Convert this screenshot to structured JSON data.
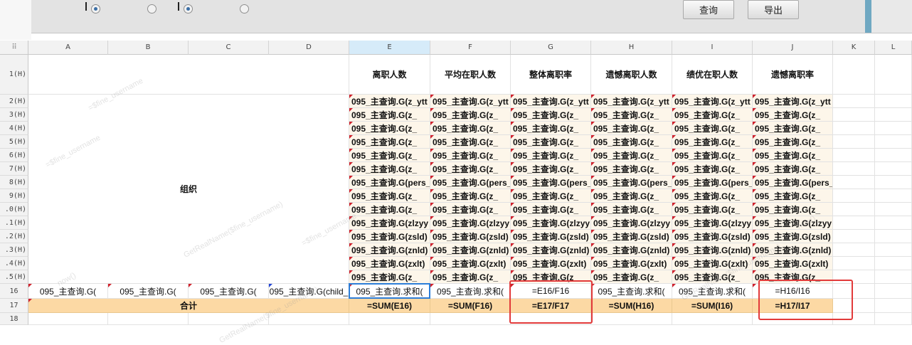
{
  "toolbar": {
    "query_label": "查询",
    "export_label": "导出"
  },
  "columns": [
    "A",
    "B",
    "C",
    "D",
    "E",
    "F",
    "G",
    "H",
    "I",
    "J",
    "K",
    "L"
  ],
  "corner_glyph": "⠿",
  "row_labels": [
    "1(H)",
    "2(H)",
    "3(H)",
    "4(H)",
    "5(H)",
    "6(H)",
    "7(H)",
    "8(H)",
    "9(H)",
    ".0(H)",
    ".1(H)",
    ".2(H)",
    ".3(H)",
    ".4(H)",
    ".5(H)",
    "16",
    "17",
    "18"
  ],
  "header_row": [
    "离职人数",
    "平均在职人数",
    "整体离职率",
    "遗憾离职人数",
    "绩优在职人数",
    "遗憾离职率"
  ],
  "org_label": "组织",
  "expr_rows": [
    [
      "095_主查询.G(z_ytt",
      "095_主查询.G(z_ytt",
      "095_主查询.G(z_ytt",
      "095_主查询.G(z_ytt",
      "095_主查询.G(z_ytt",
      "095_主查询.G(z_ytt"
    ],
    [
      "095_主查询.G(z_",
      "095_主查询.G(z_",
      "095_主查询.G(z_",
      "095_主查询.G(z_",
      "095_主查询.G(z_",
      "095_主查询.G(z_"
    ],
    [
      "095_主查询.G(z_",
      "095_主查询.G(z_",
      "095_主查询.G(z_",
      "095_主查询.G(z_",
      "095_主查询.G(z_",
      "095_主查询.G(z_"
    ],
    [
      "095_主查询.G(z_",
      "095_主查询.G(z_",
      "095_主查询.G(z_",
      "095_主查询.G(z_",
      "095_主查询.G(z_",
      "095_主查询.G(z_"
    ],
    [
      "095_主查询.G(z_",
      "095_主查询.G(z_",
      "095_主查询.G(z_",
      "095_主查询.G(z_",
      "095_主查询.G(z_",
      "095_主查询.G(z_"
    ],
    [
      "095_主查询.G(z_",
      "095_主查询.G(z_",
      "095_主查询.G(z_",
      "095_主查询.G(z_",
      "095_主查询.G(z_",
      "095_主查询.G(z_"
    ],
    [
      "095_主查询.G(pers_",
      "095_主查询.G(pers_",
      "095_主查询.G(pers_",
      "095_主查询.G(pers_",
      "095_主查询.G(pers_",
      "095_主查询.G(pers_"
    ],
    [
      "095_主查询.G(z_",
      "095_主查询.G(z_",
      "095_主查询.G(z_",
      "095_主查询.G(z_",
      "095_主查询.G(z_",
      "095_主查询.G(z_"
    ],
    [
      "095_主查询.G(z_",
      "095_主查询.G(z_",
      "095_主查询.G(z_",
      "095_主查询.G(z_",
      "095_主查询.G(z_",
      "095_主查询.G(z_"
    ],
    [
      "095_主查询.G(zlzyy",
      "095_主查询.G(zlzyy",
      "095_主查询.G(zlzyy",
      "095_主查询.G(zlzyy",
      "095_主查询.G(zlzyy",
      "095_主查询.G(zlzyy"
    ],
    [
      "095_主查询.G(zsld)",
      "095_主查询.G(zsld)",
      "095_主查询.G(zsld)",
      "095_主查询.G(zsld)",
      "095_主查询.G(zsld)",
      "095_主查询.G(zsld)"
    ],
    [
      "095_主查询.G(znld)",
      "095_主查询.G(znld)",
      "095_主查询.G(znld)",
      "095_主查询.G(znld)",
      "095_主查询.G(znld)",
      "095_主查询.G(znld)"
    ],
    [
      "095_主查询.G(zxlt)",
      "095_主查询.G(zxlt)",
      "095_主查询.G(zxlt)",
      "095_主查询.G(zxlt)",
      "095_主查询.G(zxlt)",
      "095_主查询.G(zxlt)"
    ],
    [
      "095_主查询.G(z_",
      "095_主查询.G(z_",
      "095_主查询.G(z_",
      "095_主查询.G(z_",
      "095_主查询.G(z_",
      "095_主查询.G(z_"
    ]
  ],
  "row16": [
    "095_主查询.G(",
    "095_主查询.G(",
    "095_主查询.G(",
    "095_主查询.G(child_",
    "095_主查询.求和(",
    "095_主查询.求和(",
    "=E16/F16",
    "095_主查询.求和(",
    "095_主查询.求和(",
    "=H16/I16"
  ],
  "row17": {
    "label": "合计",
    "values": [
      "=SUM(E16)",
      "=SUM(F16)",
      "=E17/F17",
      "=SUM(H16)",
      "=SUM(I16)",
      "=H17/I17"
    ]
  },
  "watermark_texts": [
    "=$fine_username",
    "GetRealName($fine_username)",
    "now()"
  ],
  "colors": {
    "selected_column": "#d6ebf9",
    "total_row": "#fcd9a4",
    "expr_fill": "#fdf6ea",
    "highlight_box": "#e23a3a",
    "selection_border": "#2d7ed8"
  }
}
